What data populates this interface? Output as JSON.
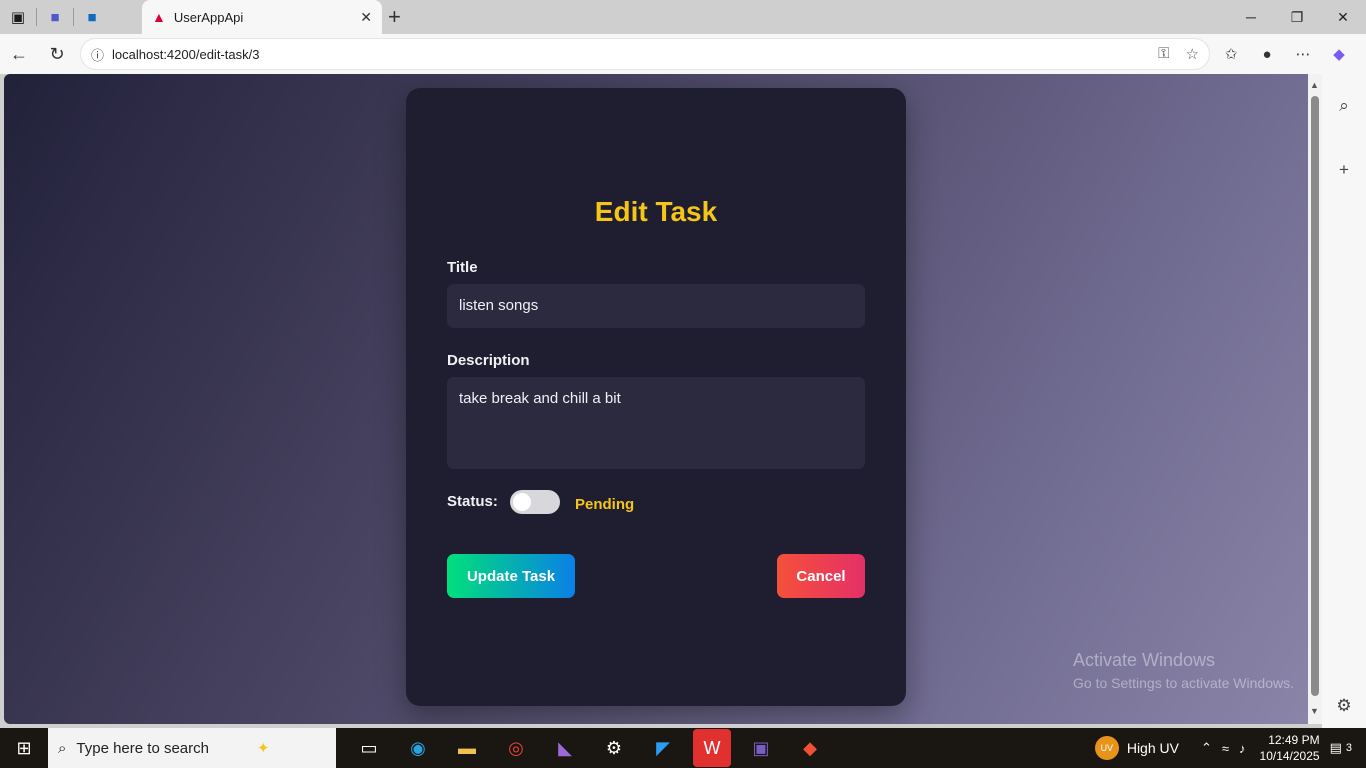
{
  "browser": {
    "tab_title": "UserAppApi",
    "url": "localhost:4200/edit-task/3"
  },
  "form": {
    "heading": "Edit Task",
    "title_label": "Title",
    "title_value": "listen songs",
    "description_label": "Description",
    "description_value": "take break and chill a bit",
    "status_label": "Status:",
    "status_value": "Pending",
    "status_on": false,
    "update_label": "Update Task",
    "cancel_label": "Cancel"
  },
  "watermark": {
    "line1": "Activate Windows",
    "line2": "Go to Settings to activate Windows."
  },
  "taskbar": {
    "search_placeholder": "Type here to search",
    "weather": "High UV",
    "weather_badge": "UV",
    "time": "12:49 PM",
    "date": "10/14/2025",
    "notifications": "3"
  },
  "colors": {
    "accent": "#f5c518",
    "card": "#1f1e30",
    "update_start": "#00e07a",
    "update_end": "#0a80e6",
    "cancel_start": "#f5503a",
    "cancel_end": "#e43068"
  }
}
